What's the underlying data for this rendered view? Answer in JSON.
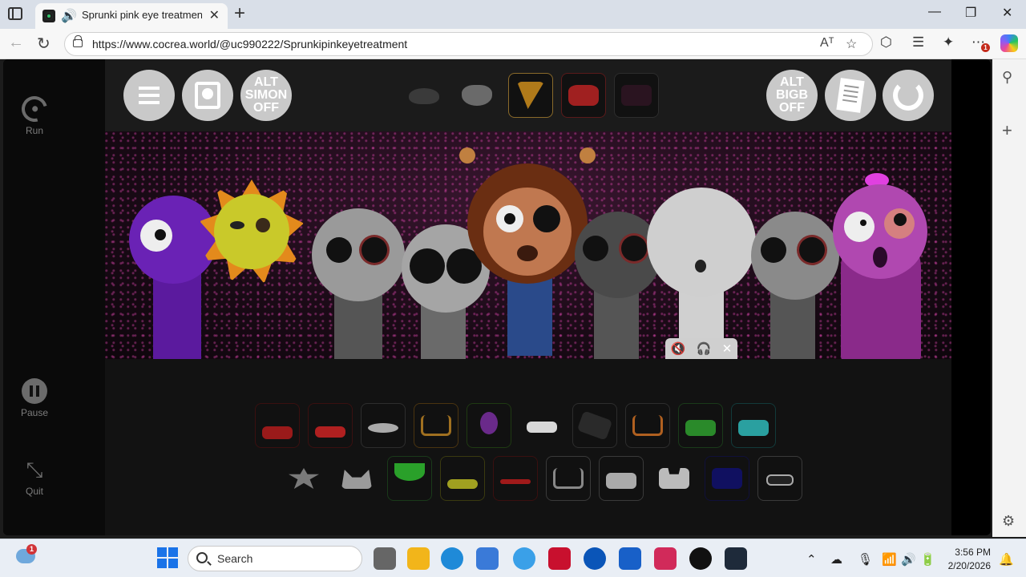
{
  "browser": {
    "tab_title": "Sprunki pink eye treatment b",
    "audio_icon": "speaker-icon",
    "new_tab": "+",
    "url": "https://www.cocrea.world/@uc990222/Sprunkipinkeyetreatment",
    "read_aloud": "Aᵀ",
    "min": "—",
    "max": "❐",
    "close": "✕",
    "extensions_badge": "1"
  },
  "controls": {
    "run_label": "Run",
    "pause_label": "Pause",
    "quit_label": "Quit"
  },
  "game": {
    "alt_simon_label": "ALT SIMON OFF",
    "alt_bigb_label": "ALT BIGB OFF",
    "mini_bar": {
      "mute": "🔇",
      "headphones": "🎧",
      "close": "✕"
    }
  },
  "taskbar": {
    "search_placeholder": "Search",
    "weather_badge": "1",
    "time": "3:56 PM",
    "date": "2/20/2026"
  }
}
